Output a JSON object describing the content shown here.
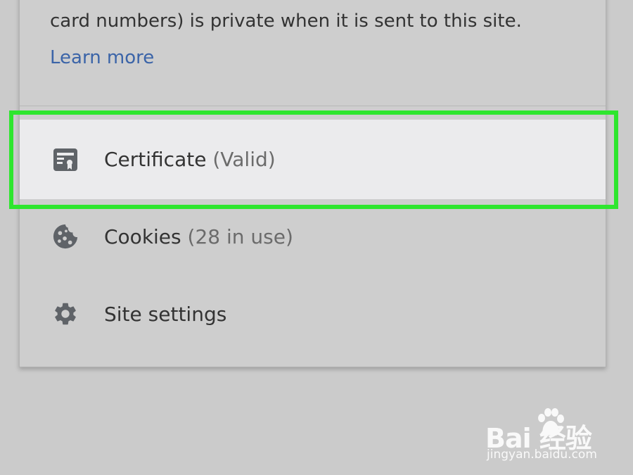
{
  "info": {
    "privacy_text": "card numbers) is private when it is sent to this site.",
    "learn_more": "Learn more"
  },
  "rows": [
    {
      "label": "Certificate",
      "sub": "(Valid)",
      "icon": "certificate-icon"
    },
    {
      "label": "Cookies",
      "sub": "(28 in use)",
      "icon": "cookie-icon"
    },
    {
      "label": "Site settings",
      "sub": "",
      "icon": "gear-icon"
    }
  ],
  "watermark": {
    "brand": "Bai  经验",
    "domain": "jingyan.baidu.com"
  },
  "colors": {
    "link": "#3b64a8",
    "highlight": "#2ee62e",
    "panel": "#cecece",
    "selected_row": "#ebebed"
  }
}
